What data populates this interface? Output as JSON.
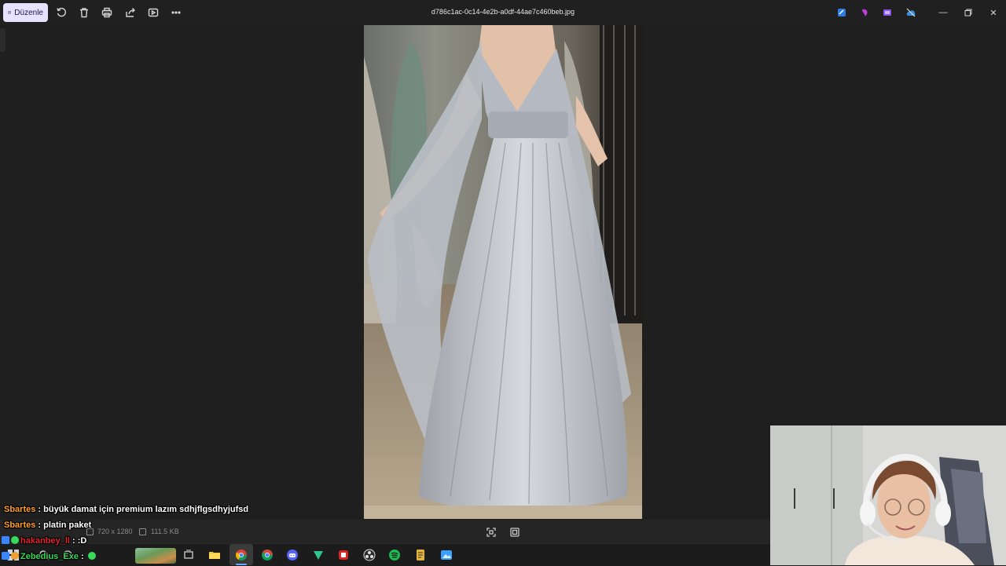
{
  "toolbar": {
    "edit_label": "Düzenle",
    "file_name": "d786c1ac-0c14-4e2b-a0df-44ae7c460beb.jpg",
    "tools": [
      "rotate-icon",
      "delete-icon",
      "print-icon",
      "share-icon",
      "slideshow-icon",
      "more-icon"
    ]
  },
  "status": {
    "dimensions": "720 x 1280",
    "file_size": "111.5 KB"
  },
  "chat": [
    {
      "user": "Sbartes",
      "message": "büyük damat için premium lazım sdhjflgsdhyjufsd"
    },
    {
      "user": "Sbartes",
      "message": "platin paket"
    },
    {
      "user": "hakanbey_ll",
      "message": ":D"
    },
    {
      "user": "Zebedius_Exe",
      "message": ""
    }
  ],
  "colors": {
    "accent_edit": "#e7e2ff",
    "background": "#1f1f1f",
    "chat_user_orange": "#ff9e2c",
    "chat_user_red": "#e0242a",
    "chat_user_green": "#39d95a"
  }
}
